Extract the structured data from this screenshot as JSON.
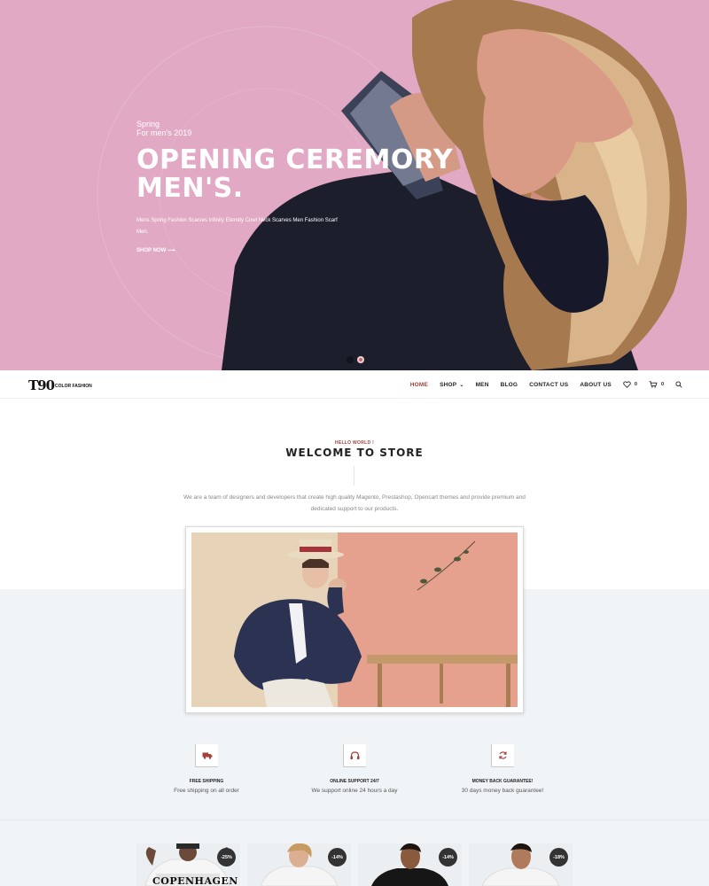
{
  "hero": {
    "season": "Spring",
    "subtitle": "For men's 2019",
    "title_line1": "OPENING CEREMORY",
    "title_line2": "MEN'S.",
    "description": "Mens Spring Fashion Scarves Infinity Eternity Cowl Neck Scarves Men Fashion Scarf Men.",
    "cta": "SHOP NOW ⟶",
    "slides": 2,
    "active_slide": 2,
    "background_color": "#e1a9c4"
  },
  "header": {
    "logo_mark": "T90",
    "logo_text": "COLOR FASHION",
    "nav": [
      {
        "label": "HOME",
        "active": true
      },
      {
        "label": "SHOP",
        "has_dropdown": true
      },
      {
        "label": "MEN"
      },
      {
        "label": "BLOG"
      },
      {
        "label": "CONTACT US"
      },
      {
        "label": "ABOUT US"
      }
    ],
    "wishlist_count": "0",
    "cart_count": "0",
    "icons": {
      "wishlist": "heart-icon",
      "cart": "cart-icon",
      "search": "search-icon",
      "dropdown": "chevron-down-icon"
    }
  },
  "welcome": {
    "eyebrow": "HELLO WORLD !",
    "title": "WELCOME TO STORE",
    "description": "We are a team of designers and developers that create high quality Magento, Prestashop, Opencart themes and provide premium and dedicated support to our products."
  },
  "services": [
    {
      "icon": "truck-icon",
      "title": "FREE SHIPPING",
      "description": "Free shipping on all order"
    },
    {
      "icon": "headphones-icon",
      "title": "ONLINE SUPPORT 24/7",
      "description": "We support online 24 hours a day"
    },
    {
      "icon": "refresh-icon",
      "title": "MONEY BACK GUARANTEE!",
      "description": "30 days money back guarantee!"
    }
  ],
  "products": [
    {
      "badge": "-25%",
      "shirt_text": "COPENHAGEN"
    },
    {
      "badge": "-14%"
    },
    {
      "badge": "-14%"
    },
    {
      "badge": "-18%"
    }
  ],
  "colors": {
    "accent": "#a6413a",
    "hero_pink": "#e1a9c4",
    "band": "#f1f4f6"
  }
}
